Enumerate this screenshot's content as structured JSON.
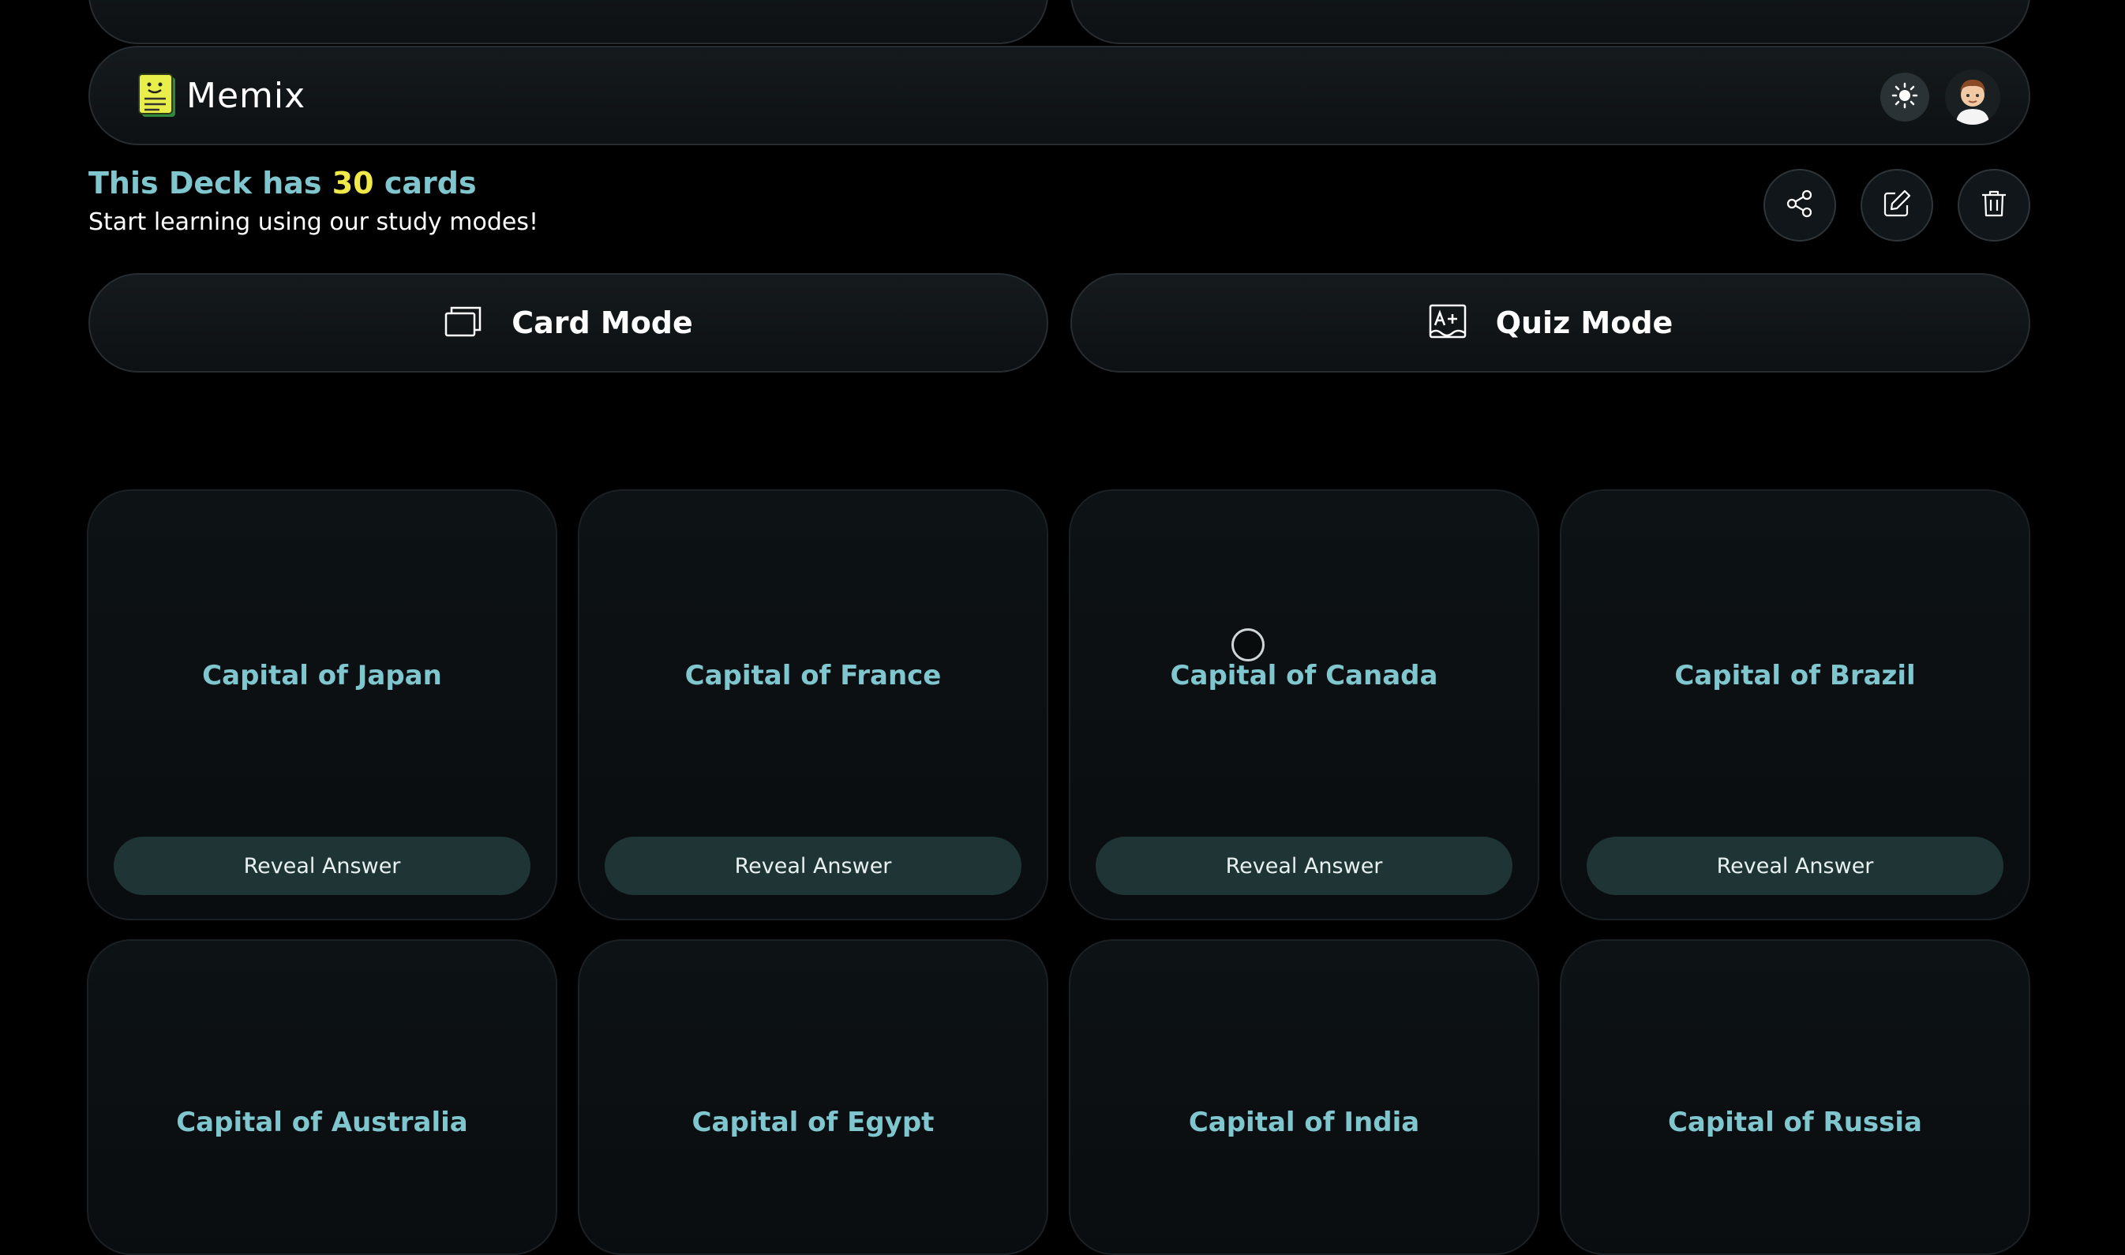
{
  "navbar": {
    "brand": "Memix",
    "logo_icon": "notepad-icon",
    "theme_icon": "sun-icon",
    "avatar_icon": "user-avatar"
  },
  "deck": {
    "title_prefix": "This Deck has ",
    "card_count": "30",
    "title_suffix": " cards",
    "subtitle": "Start learning using our study modes!"
  },
  "actions": {
    "share_icon": "share-icon",
    "edit_icon": "edit-icon",
    "delete_icon": "trash-icon"
  },
  "modes": {
    "card_mode_label": "Card Mode",
    "quiz_mode_label": "Quiz Mode"
  },
  "cards": [
    {
      "question": "Capital of Japan",
      "reveal_label": "Reveal Answer"
    },
    {
      "question": "Capital of France",
      "reveal_label": "Reveal Answer"
    },
    {
      "question": "Capital of Canada",
      "reveal_label": "Reveal Answer"
    },
    {
      "question": "Capital of Brazil",
      "reveal_label": "Reveal Answer"
    },
    {
      "question": "Capital of Australia"
    },
    {
      "question": "Capital of Egypt"
    },
    {
      "question": "Capital of India"
    },
    {
      "question": "Capital of Russia"
    }
  ],
  "colors": {
    "accent": "#7fc6cf",
    "highlight": "#f1e84a",
    "reveal_bg": "#1e3435",
    "background": "#000000"
  }
}
